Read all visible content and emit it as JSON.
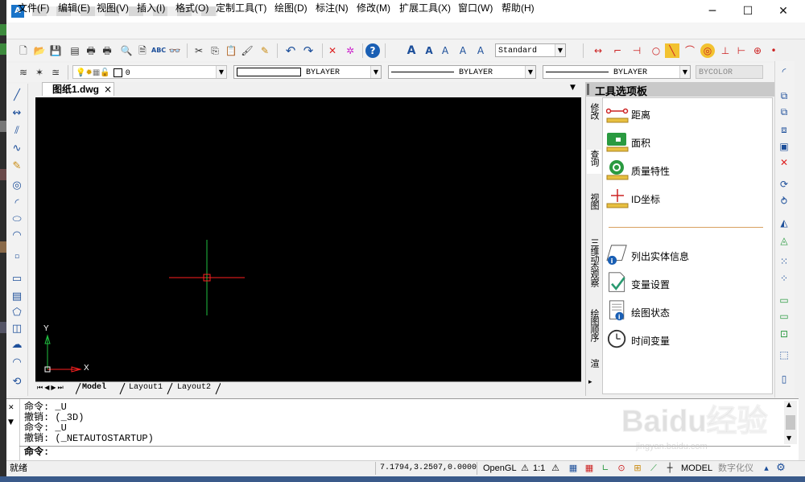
{
  "titlebar": {
    "icon_label": "A",
    "minimize": "─",
    "maximize": "☐",
    "close": "✕"
  },
  "menu": [
    "文件(F)",
    "编辑(E)",
    "视图(V)",
    "插入(I)",
    "格式(O)",
    "定制工具(T)",
    "绘图(D)",
    "标注(N)",
    "修改(M)",
    "扩展工具(X)",
    "窗口(W)",
    "帮助(H)"
  ],
  "toolbar2": {
    "layer_value": "0",
    "color_value": "BYLAYER",
    "linetype_value": "BYLAYER",
    "lineweight_value": "BYLAYER",
    "plotstyle_value": "BYCOLOR",
    "textstyle_value": "Standard"
  },
  "document": {
    "tab_label": "图纸1.dwg",
    "close_glyph": "×",
    "tab_menu": "▼"
  },
  "axes": {
    "x_label": "X",
    "y_label": "Y"
  },
  "layouts": [
    "Model",
    "Layout1",
    "Layout2"
  ],
  "palette": {
    "title": "工具选项板",
    "tabs": [
      "修改(M)",
      "查询",
      "视图",
      "三维动态观察",
      "绘图顺序",
      "渲"
    ],
    "items": [
      "距离",
      "面积",
      "质量特性",
      "ID坐标",
      "列出实体信息",
      "变量设置",
      "绘图状态",
      "时间变量"
    ]
  },
  "command": {
    "history": [
      "命令:  _U",
      "撤销: (_3D)",
      "命令:  _U",
      "撤销: (_NETAUTOSTARTUP)"
    ],
    "prompt": "命令:"
  },
  "status": {
    "ready": "就绪",
    "coords": "7.1794,3.2507,0.0000",
    "renderer": "OpenGL",
    "scale": "1:1",
    "space": "MODEL",
    "digitizer": "数字化仪"
  },
  "watermark": {
    "brand": "Baidu经验",
    "url": "jingyan.baidu.com"
  },
  "colors": {
    "canvas": "#000000",
    "crosshair_x": "#ff2020",
    "crosshair_y": "#20c040",
    "accent": "#1a74c9"
  }
}
